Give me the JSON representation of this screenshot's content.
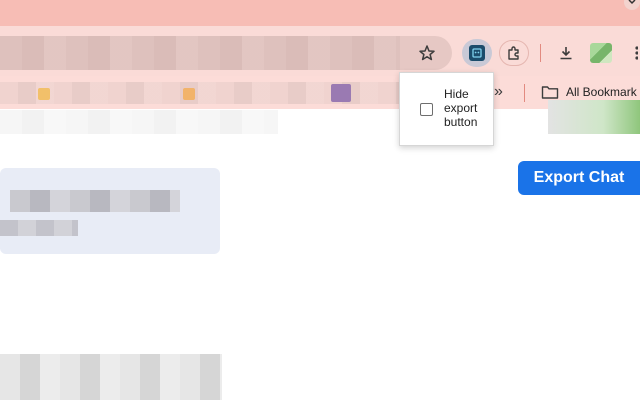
{
  "browser": {
    "titlebar_color": "#f7bdb5",
    "toolbar_color": "#fadbd7",
    "icons": [
      "chevron-down-icon",
      "star-icon",
      "extension-icon",
      "puzzle-icon",
      "download-icon",
      "profile-icon",
      "kebab-menu-icon"
    ]
  },
  "bookmarks_bar": {
    "overflow_label": "»",
    "all_bookmarks_label": "All Bookmark"
  },
  "extension_popup": {
    "checkbox_label": "Hide export button",
    "checked": false
  },
  "page": {
    "export_button_label": "Export Chat",
    "accent_color": "#1a73e8"
  }
}
